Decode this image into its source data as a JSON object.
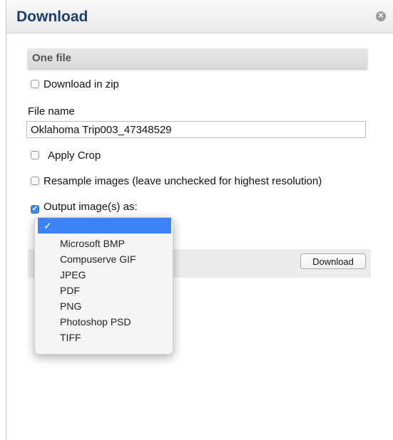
{
  "dialog": {
    "title": "Download",
    "close_glyph": "✕",
    "section_title": "One file",
    "download_zip_label": "Download in zip",
    "file_name_label": "File name",
    "file_name_value": "Oklahoma Trip003_47348529",
    "apply_crop_label": "Apply Crop",
    "resample_label": "Resample images (leave unchecked for highest resolution)",
    "output_as_label": "Output image(s) as:",
    "download_button": "Download"
  },
  "checkboxes": {
    "download_zip": false,
    "apply_crop": false,
    "resample": false,
    "output_as": true
  },
  "format_dropdown": {
    "selected_glyph": "✓",
    "options": [
      "Microsoft BMP",
      "Compuserve GIF",
      "JPEG",
      "PDF",
      "PNG",
      "Photoshop PSD",
      "TIFF"
    ]
  },
  "colors": {
    "title": "#1d3f6e",
    "selection": "#3e82f7",
    "checkbox_checked": "#3b8ae3"
  },
  "icons": [
    "close-icon",
    "checkmark-icon"
  ]
}
